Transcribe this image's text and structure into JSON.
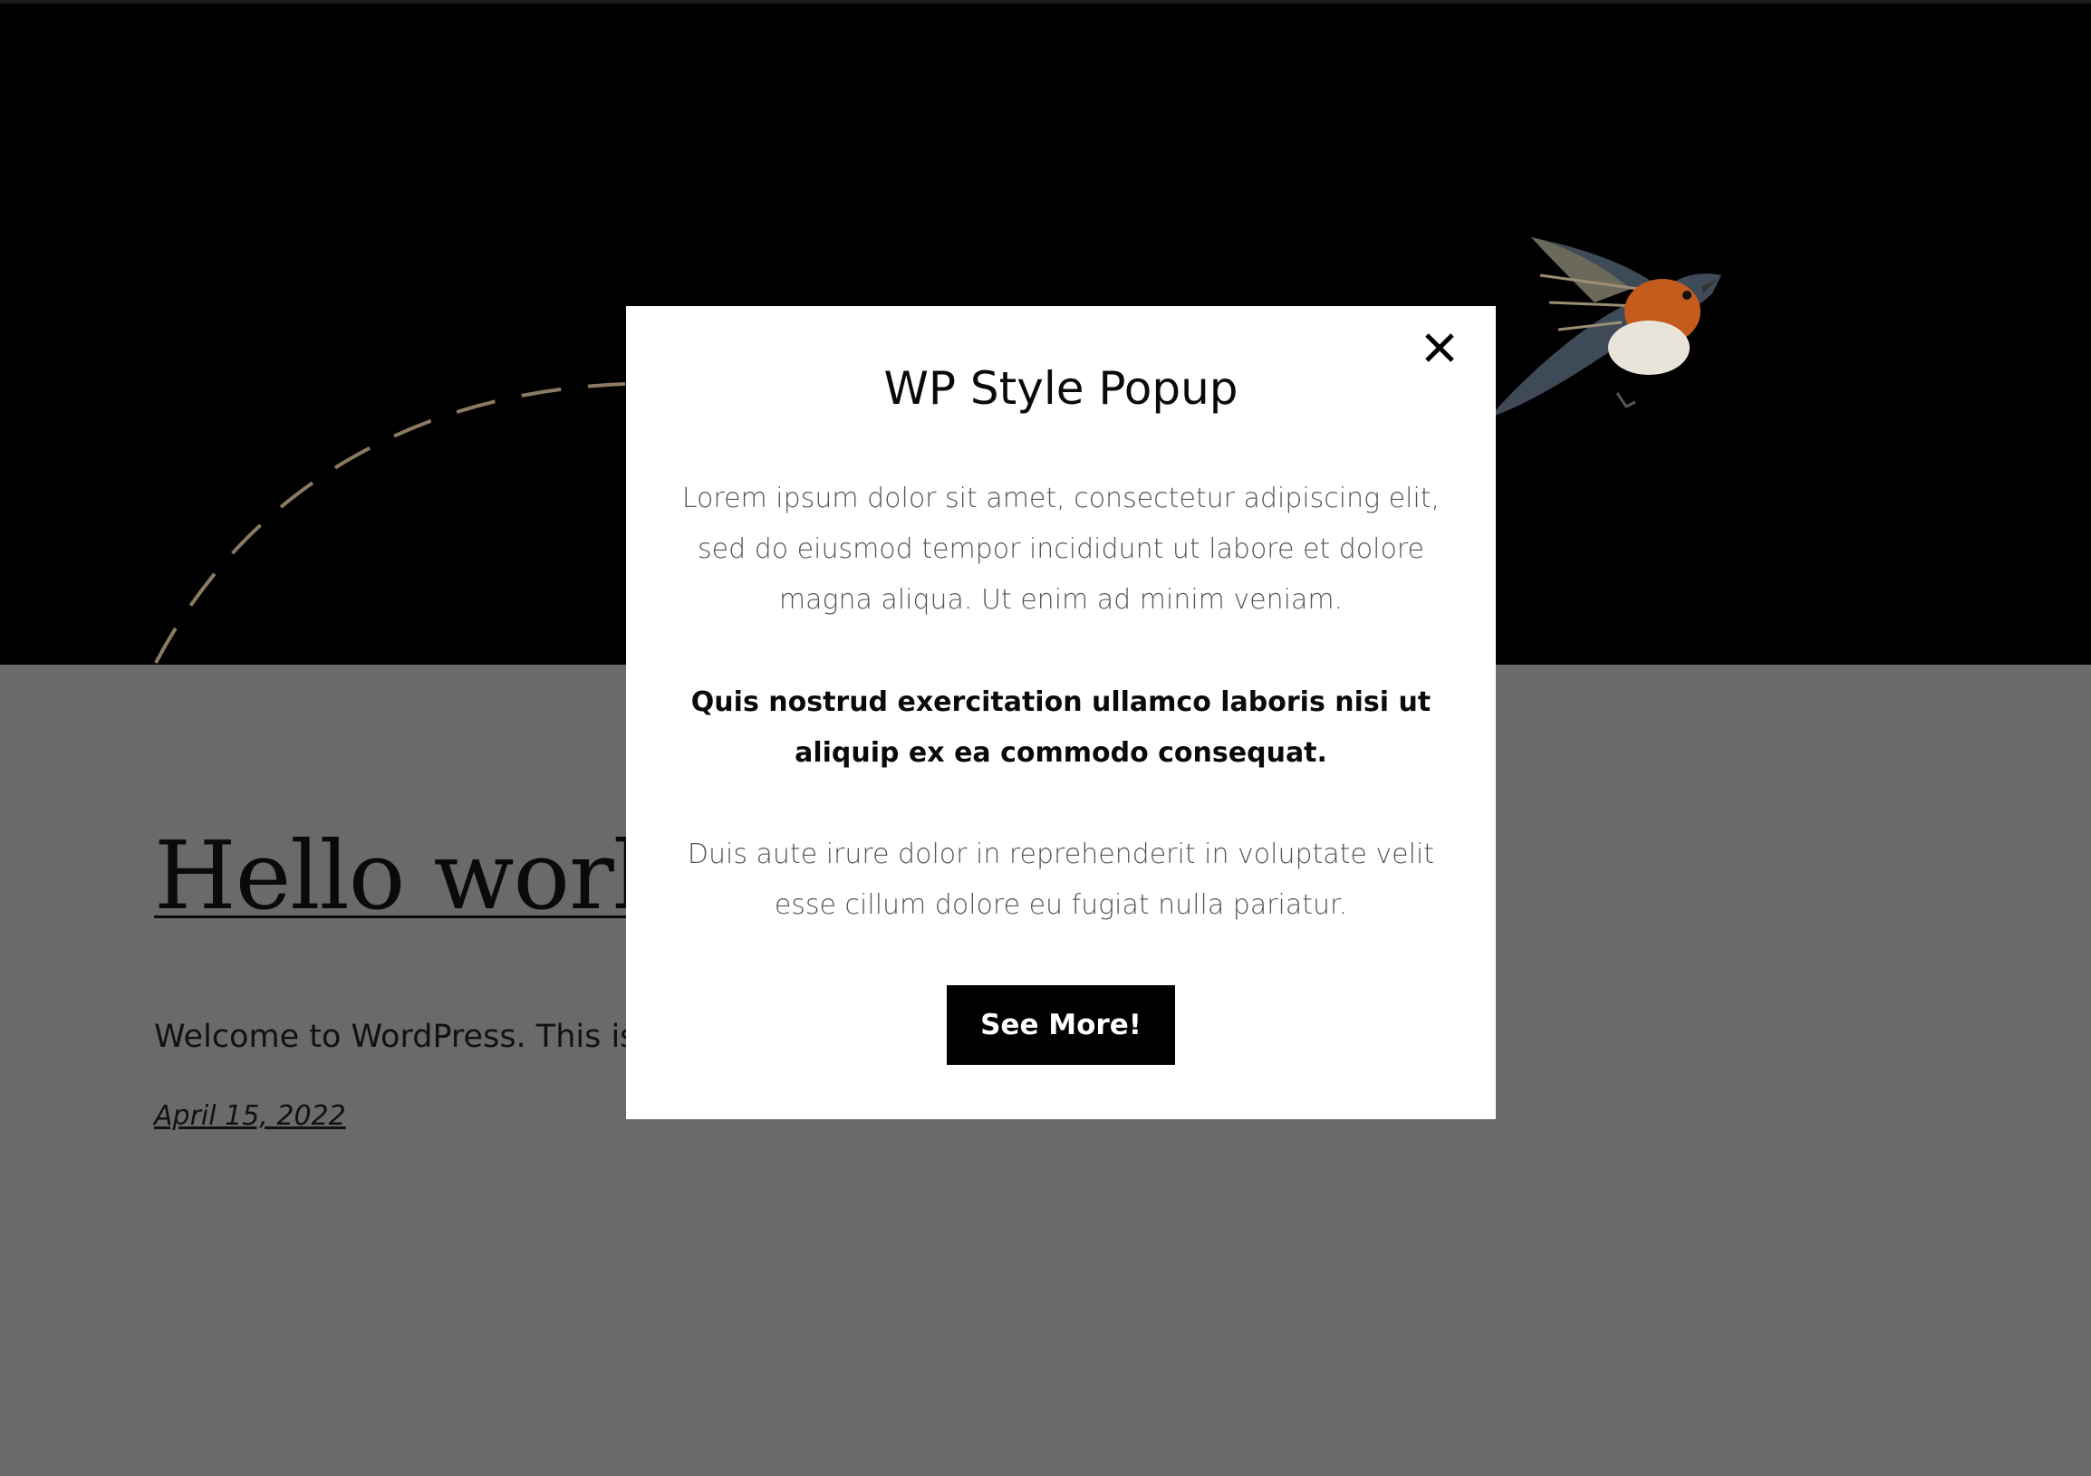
{
  "post": {
    "title": "Hello world!",
    "excerpt": "Welcome to WordPress. This is yo",
    "date": "April 15, 2022"
  },
  "popup": {
    "title": "WP Style Popup",
    "paragraph_1": "Lorem ipsum dolor sit amet, consectetur adipiscing elit, sed do eiusmod tempor incididunt ut labore et dolore magna aliqua. Ut enim ad minim veniam.",
    "paragraph_2": "Quis nostrud exercitation ullamco laboris nisi ut aliquip ex ea commodo consequat.",
    "paragraph_3": "Duis aute irure dolor in reprehenderit in voluptate velit esse cillum dolore eu fugiat nulla pariatur.",
    "button_label": "See More!",
    "close_icon": "close-icon"
  },
  "colors": {
    "hero_background": "#000000",
    "page_background": "#6a6a6a",
    "popup_background": "#ffffff",
    "button_background": "#000000",
    "dashed_arc": "#8c7b62"
  }
}
